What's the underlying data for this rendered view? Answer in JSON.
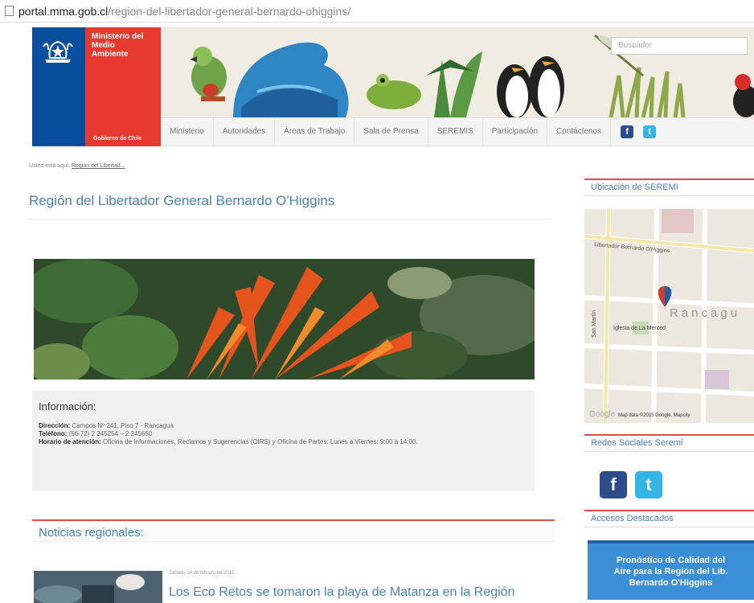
{
  "browser": {
    "url_domain": "portal.mma.gob.cl",
    "url_path": "/region-del-libertador-general-bernardo-ohiggins/"
  },
  "header": {
    "ministry_lines": [
      "Ministerio del",
      "Medio",
      "Ambiente"
    ],
    "gobierno": "Gobierno de Chile",
    "search_placeholder": "Buscador"
  },
  "nav": {
    "items": [
      "Ministerio",
      "Autoridades",
      "Áreas de Trabajo",
      "Sala de Prensa",
      "SEREMIS",
      "Participación",
      "Contáctenos"
    ],
    "facebook_glyph": "f",
    "twitter_glyph": "t"
  },
  "breadcrumb": {
    "prefix": "Usted está aquí:",
    "link": "Región del Libertad..."
  },
  "main": {
    "title": "Región del Libertador General Bernardo O'Higgins",
    "info": {
      "heading": "Información:",
      "address_label": "Dirección:",
      "address": "Campos Nº 241, Piso 7 - Rancagua",
      "phone_label": "Teléfono:",
      "phone": "(56-72) 2 245254 – 2 245650",
      "hours_label": "Horario de atención:",
      "hours": "Oficina de Informaciones, Reclamos y Sugerencias (OIRS) y Oficina de Partes: Lunes a Viernes: 9:00 a 14:00."
    },
    "news_heading": "Noticias regionales:",
    "news": [
      {
        "date": "Sábado 14 de febrero de 2015",
        "title": "Los Eco Retos se tomaron la playa de Matanza en la Región"
      }
    ]
  },
  "sidebar": {
    "map_heading": "Ubicación de SEREMI",
    "map_labels": {
      "street": "Libertador Bernardo O'Higgins",
      "city": "Rancagu",
      "church": "Iglesia de La Merced",
      "san_martin": "San Martín",
      "google": "Google",
      "attribution": "Map data ©2015 Google, Mapcity"
    },
    "social_heading": "Redes Sociales Seremi",
    "facebook_glyph": "f",
    "twitter_glyph": "t",
    "featured_heading": "Accesos Destacados",
    "air_quality": [
      "Pronóstico de Calidad del",
      "Aire para la Región del Lib.",
      "Bernardo O'Higgins"
    ]
  },
  "colors": {
    "blue": "#0a4f9e",
    "red": "#e8392f",
    "link": "#4b82b5",
    "accent_red": "#e54a4a"
  }
}
